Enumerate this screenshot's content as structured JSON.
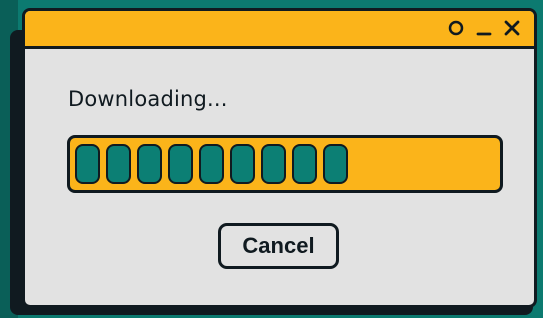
{
  "dialog": {
    "status_text": "Downloading...",
    "progress": {
      "filled_segments": 9,
      "segment_color": "#0c7f74",
      "track_color": "#fbb41a"
    },
    "cancel_label": "Cancel"
  },
  "titlebar": {
    "controls": [
      "circle-icon",
      "minimize-icon",
      "close-icon"
    ],
    "color": "#fbb41a"
  },
  "colors": {
    "background": "#0c7a70",
    "window": "#e2e2e2",
    "outline": "#101a20"
  }
}
